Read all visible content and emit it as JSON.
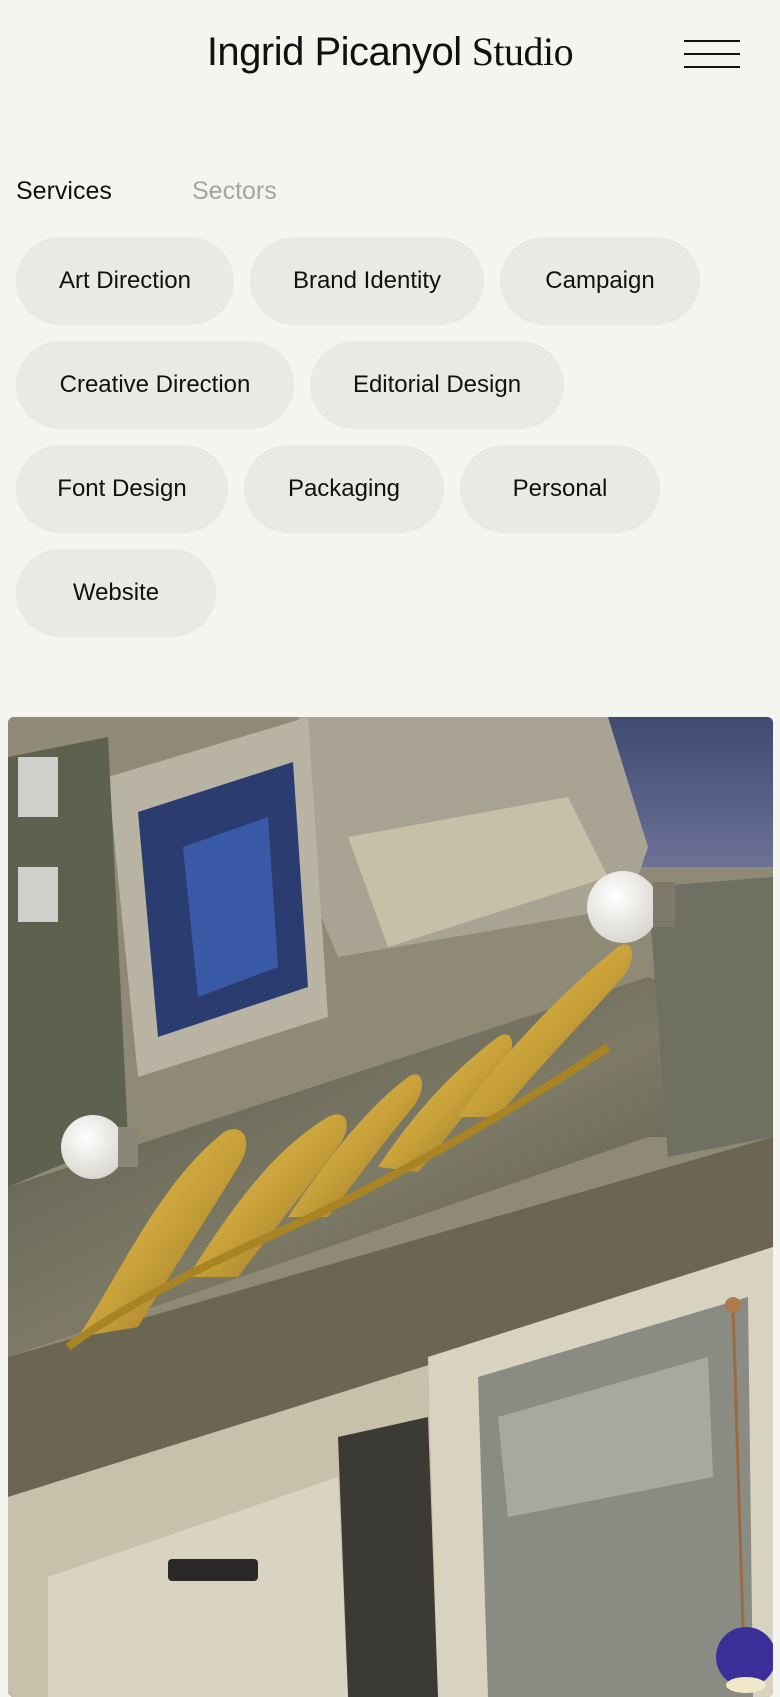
{
  "header": {
    "brand_name": "Ingrid Picanyol",
    "brand_suffix": "Studio",
    "menu_icon": "hamburger-menu-icon"
  },
  "filters": {
    "tabs": [
      {
        "label": "Services",
        "active": true
      },
      {
        "label": "Sectors",
        "active": false
      }
    ],
    "chips": [
      {
        "label": "Art Direction"
      },
      {
        "label": "Brand Identity"
      },
      {
        "label": "Campaign"
      },
      {
        "label": "Creative Direction"
      },
      {
        "label": "Editorial Design"
      },
      {
        "label": "Font Design"
      },
      {
        "label": "Packaging"
      },
      {
        "label": "Personal"
      },
      {
        "label": "Website"
      }
    ]
  },
  "hero": {
    "image": "storefront-photo"
  },
  "colors": {
    "background": "#f5f5f0",
    "chip": "#ebe9e4",
    "text": "#111111",
    "inactive_tab": "#a5a5a0",
    "gold_sign": "#c9a23a"
  }
}
